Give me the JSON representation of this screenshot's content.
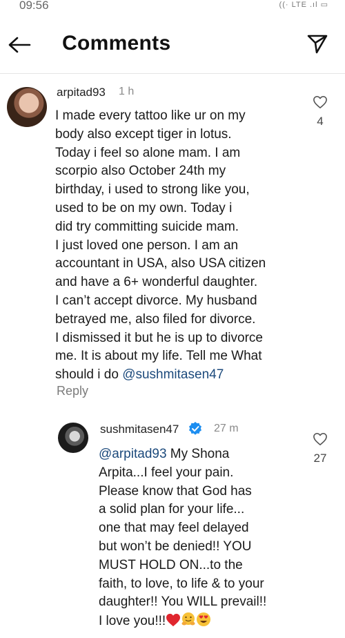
{
  "status_bar": {
    "time": "09:56",
    "icons_text": "((· LTE .ıl ▭"
  },
  "header": {
    "title": "Comments"
  },
  "comments": [
    {
      "username": "arpitad93",
      "time": "1 h",
      "text": "I made every tattoo like ur on my\nbody also except tiger in lotus.\nToday i feel so alone mam. I am\nscorpio also October 24th my\nbirthday, i used to strong like you,\nused to be on my own. Today i\ndid try committing suicide mam.\nI just loved one person. I am an\naccountant in USA, also USA citizen\nand have a 6+ wonderful daughter.\nI can’t accept divorce. My husband\nbetrayed me, also filed for divorce.\nI dismissed it but he is up to divorce\nme. It is about my life. Tell me  What\nshould i do ",
      "mention": "@sushmitasen47",
      "likes": "4",
      "reply_label": "Reply"
    },
    {
      "username": "sushmitasen47",
      "time": "27 m",
      "mention": "@arpitad93",
      "text": " My Shona\nArpita...I feel your pain.\nPlease know that God has\na solid plan for your life...\none that may feel delayed\nbut won’t be denied!! YOU\nMUST HOLD ON...to the\nfaith, to love, to life & to your\ndaughter!! You WILL prevail!!\nI love you!!!",
      "emojis": [
        "heart",
        "hugging-face",
        "heart-eyes-face"
      ],
      "likes": "27"
    }
  ],
  "colors": {
    "mention": "#1c4a7c",
    "verified": "#1d8ef0",
    "heart_emoji": "#e0262e",
    "emoji_face": "#f7c137"
  }
}
